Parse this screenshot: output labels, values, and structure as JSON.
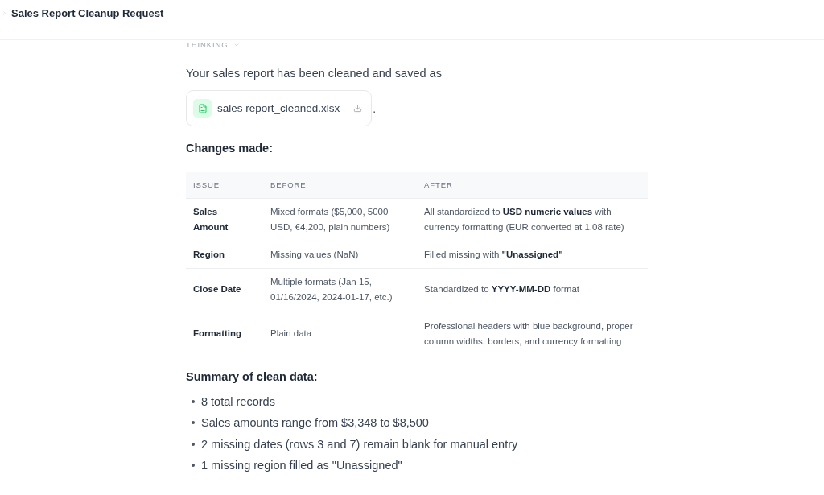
{
  "header": {
    "title": "Sales Report Cleanup Request"
  },
  "thinking": {
    "label": "THINKING"
  },
  "message": {
    "intro": "Your sales report has been cleaned and saved as",
    "attachment": {
      "filename": "sales report_cleaned.xlsx"
    },
    "trailing": "."
  },
  "changes": {
    "heading": "Changes made:",
    "table": {
      "columns": [
        "ISSUE",
        "BEFORE",
        "AFTER"
      ],
      "rows": [
        {
          "issue": "Sales Amount",
          "before": "Mixed formats ($5,000, 5000 USD, €4,200, plain numbers)",
          "after": "All standardized to **USD numeric values** with currency formatting (EUR converted at 1.08 rate)"
        },
        {
          "issue": "Region",
          "before": "Missing values (NaN)",
          "after": "Filled missing with **\"Unassigned\"**"
        },
        {
          "issue": "Close Date",
          "before": "Multiple formats (Jan 15, 01/16/2024, 2024-01-17, etc.)",
          "after": "Standardized to **YYYY-MM-DD** format"
        },
        {
          "issue": "Formatting",
          "before": "Plain data",
          "after": "Professional headers with blue background, proper column widths, borders, and currency formatting"
        }
      ]
    }
  },
  "summary": {
    "heading": "Summary of clean data:",
    "items": [
      "8 total records",
      "Sales amounts range from $3,348 to $8,500",
      "2 missing dates (rows 3 and 7) remain blank for manual entry",
      "1 missing region filled as \"Unassigned\""
    ]
  }
}
